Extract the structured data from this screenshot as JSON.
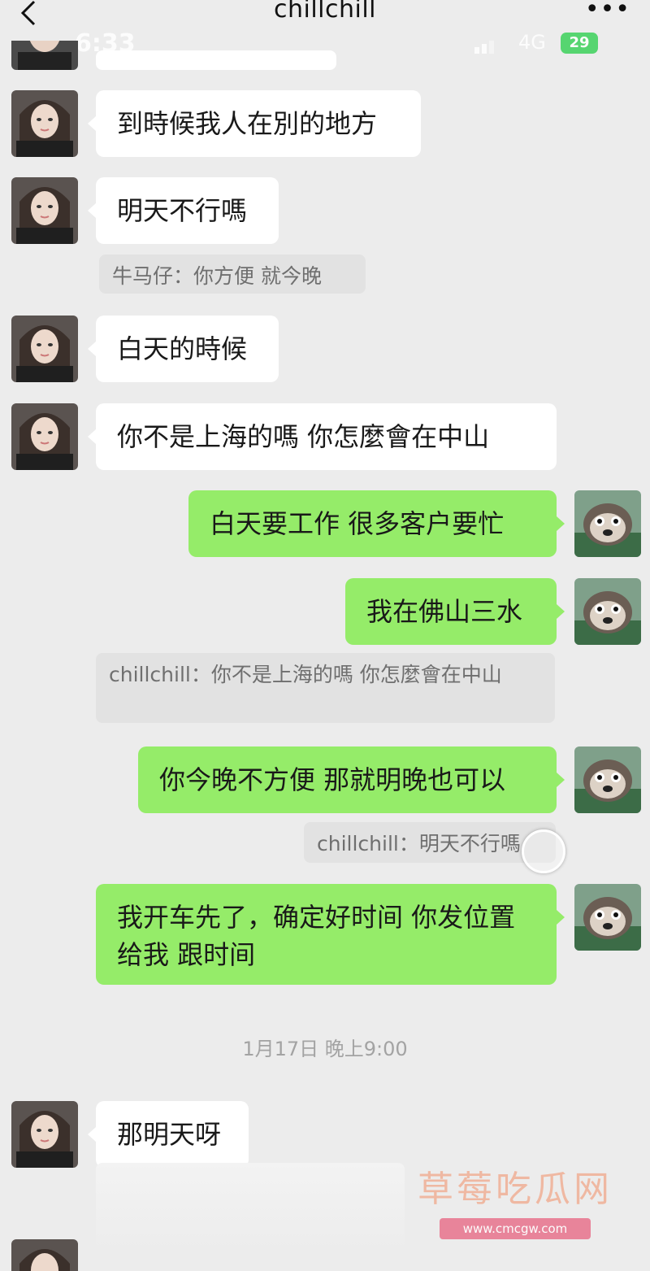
{
  "header": {
    "title": "chillchill",
    "back_icon": "chevron-left-icon",
    "more_label": "•••"
  },
  "status_bar": {
    "time": "6:33",
    "network": "4G",
    "battery": "29"
  },
  "messages": [
    {
      "side": "left",
      "text": "到時候我人在別的地方"
    },
    {
      "side": "left",
      "text": "明天不行嗎"
    },
    {
      "type": "quote",
      "text": "牛马仔：你方便 就今晚"
    },
    {
      "side": "left",
      "text": "白天的時候"
    },
    {
      "side": "left",
      "text": "你不是上海的嗎 你怎麼會在中山"
    },
    {
      "side": "right",
      "text": "白天要工作  很多客户要忙"
    },
    {
      "side": "right",
      "text": "我在佛山三水"
    },
    {
      "type": "quote",
      "text": "chillchill：你不是上海的嗎 你怎麼會在中山"
    },
    {
      "side": "right",
      "text": "你今晚不方便 那就明晚也可以"
    },
    {
      "type": "quote",
      "text": "chillchill：明天不行嗎"
    },
    {
      "side": "right",
      "text": "我开车先了，确定好时间 你发位置给我 跟时间"
    },
    {
      "side": "left",
      "text": "那明天呀"
    }
  ],
  "timestamp": "1月17日 晚上9:00",
  "watermark": {
    "title": "草莓吃瓜网",
    "url": "www.cmcgw.com"
  },
  "colors": {
    "bubble_green": "#95ec69",
    "bubble_white": "#ffffff",
    "background": "#ececec"
  }
}
